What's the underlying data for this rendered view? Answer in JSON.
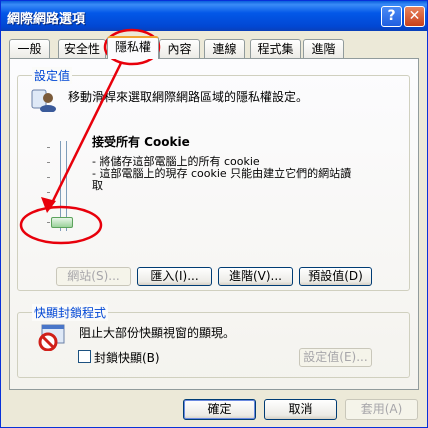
{
  "window": {
    "title": "網際網路選項",
    "help_glyph": "?",
    "close_glyph": "✕"
  },
  "tabs": [
    {
      "label": "一般"
    },
    {
      "label": "安全性"
    },
    {
      "label": "隱私權"
    },
    {
      "label": "內容"
    },
    {
      "label": "連線"
    },
    {
      "label": "程式集"
    },
    {
      "label": "進階"
    }
  ],
  "settings": {
    "group_label": "設定值",
    "instruction": "移動滑桿來選取網際網路區域的隱私權設定。",
    "level_title": "接受所有 Cookie",
    "level_desc_1": "- 將儲存這部電腦上的所有 cookie",
    "level_desc_2": "- 這部電腦上的現存 cookie 只能由建立它們的網站讀",
    "level_desc_3": "取",
    "buttons": {
      "sites": "網站(S)...",
      "import": "匯入(I)...",
      "advanced": "進階(V)...",
      "default": "預設值(D)"
    }
  },
  "popup": {
    "group_label": "快顯封鎖程式",
    "description": "阻止大部份快顯視窗的顯現。",
    "checkbox_label": "封鎖快顯(B)",
    "checkbox_checked": false,
    "settings_button": "設定值(E)..."
  },
  "footer": {
    "ok": "確定",
    "cancel": "取消",
    "apply": "套用(A)"
  },
  "annotation_color": "#e8000b"
}
